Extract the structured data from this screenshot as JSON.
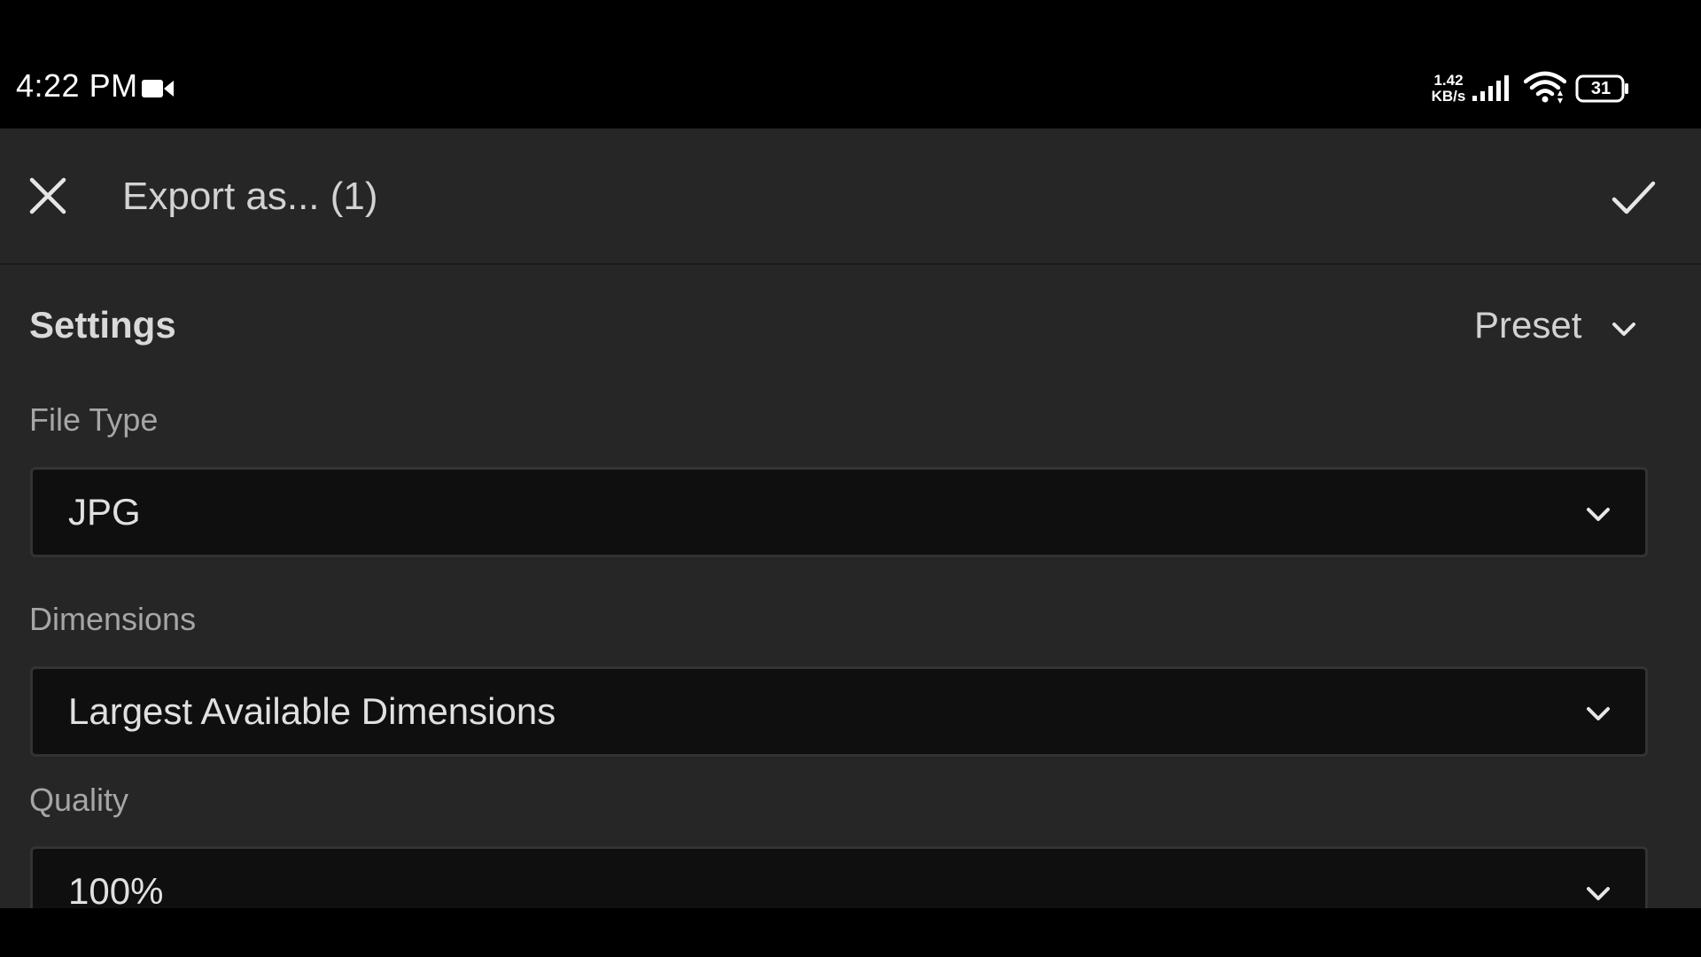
{
  "status_bar": {
    "time": "4:22 PM",
    "net_speed_value": "1.42",
    "net_speed_unit": "KB/s",
    "battery": "31"
  },
  "header": {
    "title": "Export as... (1)",
    "close_icon": "close-icon",
    "confirm_icon": "checkmark-icon"
  },
  "settings": {
    "title": "Settings",
    "preset_label": "Preset"
  },
  "fields": {
    "file_type": {
      "label": "File Type",
      "value": "JPG"
    },
    "dimensions": {
      "label": "Dimensions",
      "value": "Largest Available Dimensions"
    },
    "quality": {
      "label": "Quality",
      "value": "100%"
    }
  },
  "colors": {
    "background": "#262626",
    "select_background": "#0f0f0f",
    "label": "#a6a6a6",
    "text": "#e0e0e0"
  }
}
